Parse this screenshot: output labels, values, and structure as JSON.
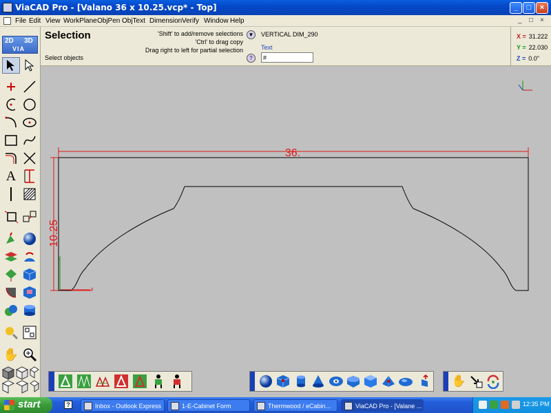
{
  "window": {
    "title": "ViaCAD Pro - [Valano 36 x 10.25.vcp* - Top]",
    "controls": [
      "_",
      "□",
      "×"
    ]
  },
  "menu": {
    "items": [
      "File",
      "Edit",
      "View",
      "WorkPlane",
      "ObjPen",
      "ObjText",
      "Dimension",
      "Verify",
      "Window",
      "Help"
    ],
    "mdi_controls": [
      "_",
      "□",
      "×"
    ]
  },
  "left_toolbar": {
    "tools": [
      "select-arrow",
      "partial-select-arrow",
      "point",
      "line",
      "arc",
      "circle",
      "arc-tangent",
      "ellipse",
      "rectangle",
      "spline",
      "fillet",
      "trim",
      "text",
      "dimension",
      "divider",
      "hatch",
      "workplane",
      "snap",
      "extrude",
      "sphere",
      "planes",
      "revolve",
      "loft",
      "box",
      "fillet-solid",
      "shell",
      "boolean",
      "cylinder",
      "light",
      "layers",
      "pan-hand",
      "zoom"
    ],
    "view_badges": {
      "two_d": "2D",
      "three_d": "3D",
      "via": "VIA"
    }
  },
  "selection_panel": {
    "title": "Selection",
    "prompt": "Select objects",
    "hints": [
      "'Shift' to add/remove selections",
      "'Ctrl' to drag copy",
      "Drag right to left for partial selection"
    ],
    "object_name": "VERTICAL DIM_290",
    "text_label": "Text",
    "text_value": "#",
    "help_icon": "?",
    "dropdown_icon": "▼"
  },
  "coordinates": {
    "x_label": "X =",
    "x_value": "31.222",
    "y_label": "Y =",
    "y_value": "22.030",
    "z_label": "Z =",
    "z_value": "0.0\""
  },
  "drawing": {
    "dim_width": "36.",
    "dim_height": "10.25",
    "dimension_color": "#e01818",
    "profile_color": "#000000",
    "axis_x_label": "x",
    "axis_y_label": "y",
    "background": "#c0c0c0"
  },
  "bottom_strips": {
    "left": [
      "select-all-icon",
      "select-chain-icon",
      "select-similar-icon",
      "select-region-icon",
      "select-edit-icon",
      "select-green-figure-icon",
      "select-red-figure-icon"
    ],
    "center": [
      "sphere-shaded-icon",
      "solid-box-icon",
      "cylinder-icon",
      "cone-icon",
      "torus-eye-icon",
      "sphere-hole-icon",
      "cube-icon",
      "pyramid-icon",
      "ellipsoid-icon",
      "box-arrow-icon"
    ],
    "right": [
      "hand-pan-icon",
      "hand-zoom-icon",
      "rotate-icon"
    ]
  },
  "taskbar": {
    "start_label": "start",
    "tasks": [
      {
        "label": "Inbox - Outlook Express",
        "active": false
      },
      {
        "label": "1-E-Cabinet Form",
        "active": false
      },
      {
        "label": "Thermwood / eCabin...",
        "active": false
      },
      {
        "label": "ViaCAD Pro - [Valane ...",
        "active": true
      }
    ],
    "clock": "12:35 PM"
  }
}
